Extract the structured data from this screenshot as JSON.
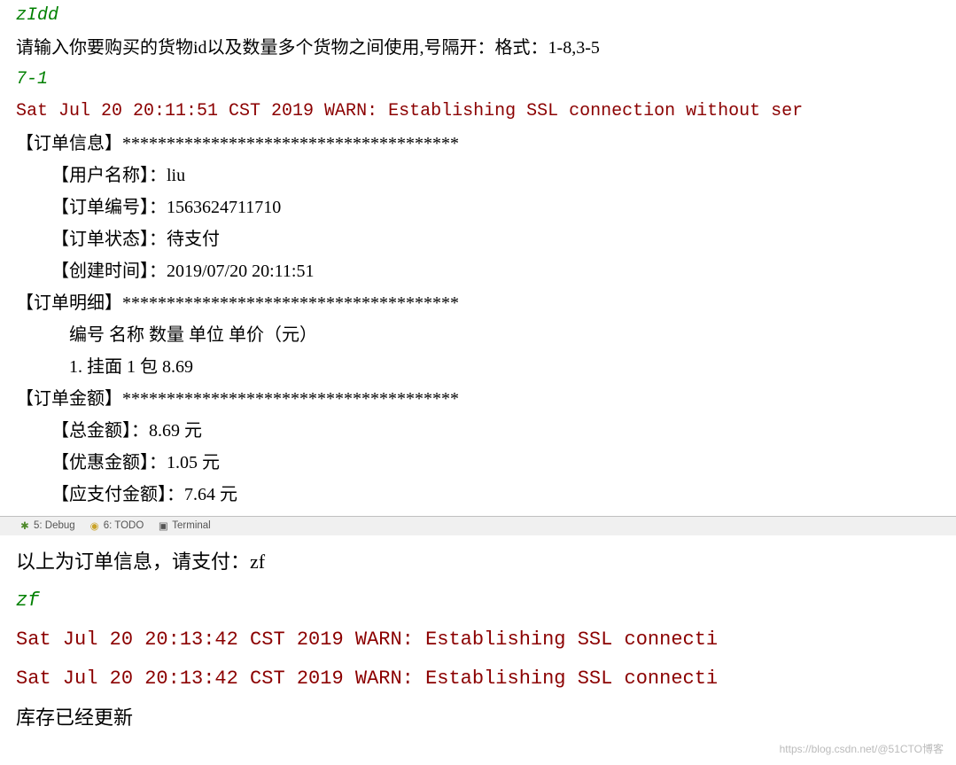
{
  "top": {
    "line1": "zIdd",
    "line2": "请输入你要购买的货物id以及数量多个货物之间使用,号隔开：格式：1-8,3-5",
    "line3": "7-1",
    "line4": "Sat Jul 20 20:11:51 CST 2019 WARN: Establishing SSL connection without ser",
    "orderInfoHeader": "【订单信息】**************************************",
    "userName": "【用户名称】：liu",
    "orderNo": "【订单编号】：1563624711710",
    "orderStatus": "【订单状态】：待支付",
    "createTime": "【创建时间】：2019/07/20 20:11:51",
    "orderDetailHeader": "【订单明细】**************************************",
    "detailTitle": "编号    名称      数量      单位      单价（元）",
    "detailRow": "1.   挂面    1    包   8.69",
    "orderAmountHeader": "【订单金额】**************************************",
    "totalAmount": "【总金额】：8.69 元",
    "discountAmount": "【优惠金额】：1.05 元",
    "payAmount": "【应支付金额】：7.64 元"
  },
  "tabs": {
    "debug": "5: Debug",
    "todo": "6: TODO",
    "terminal": "Terminal"
  },
  "bottom": {
    "line1": "以上为订单信息，请支付：zf",
    "line2": "zf",
    "line3": "Sat Jul 20 20:13:42 CST 2019 WARN: Establishing SSL connecti",
    "line4": "Sat Jul 20 20:13:42 CST 2019 WARN: Establishing SSL connecti",
    "line5": "库存已经更新"
  },
  "watermark": "https://blog.csdn.net/@51CTO博客"
}
